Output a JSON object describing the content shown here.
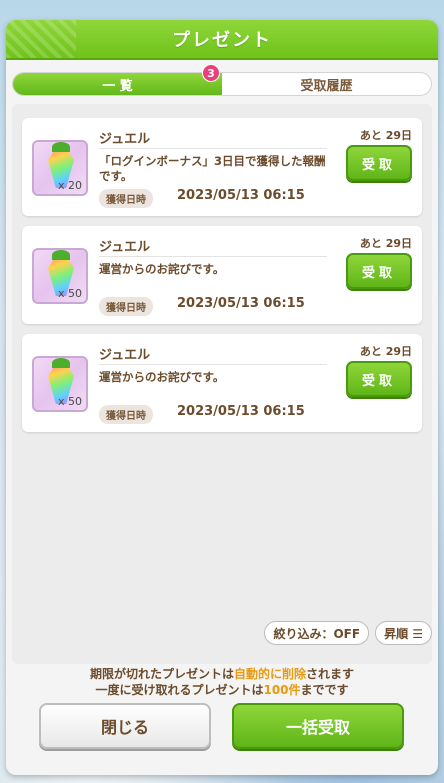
{
  "header": {
    "title": "プレゼント"
  },
  "tabs": [
    {
      "label": "一 覧",
      "badge": "3"
    },
    {
      "label": "受取履歴"
    }
  ],
  "items": [
    {
      "name": "ジュエル",
      "quantity": "x 20",
      "description": "「ログインボーナス」3日目で獲得した報酬です。",
      "date_label": "獲得日時",
      "date": "2023/05/13 06:15",
      "deadline": "あと 29日",
      "button": "受取"
    },
    {
      "name": "ジュエル",
      "quantity": "x 50",
      "description": "運営からのお詫びです。",
      "date_label": "獲得日時",
      "date": "2023/05/13 06:15",
      "deadline": "あと 29日",
      "button": "受取"
    },
    {
      "name": "ジュエル",
      "quantity": "x 50",
      "description": "運営からのお詫びです。",
      "date_label": "獲得日時",
      "date": "2023/05/13 06:15",
      "deadline": "あと 29日",
      "button": "受取"
    }
  ],
  "filters": {
    "narrow": "絞り込み：OFF",
    "sort": "昇順 ☰"
  },
  "notice": {
    "line1_pre": "期限が切れたプレゼントは",
    "line1_hl": "自動的に削除",
    "line1_post": "されます",
    "line2_pre": "一度に受け取れるプレゼントは",
    "line2_hl": "100件",
    "line2_post": "までです"
  },
  "buttons": {
    "close": "閉じる",
    "bulk": "一括受取"
  },
  "colors": {
    "accent_green": "#6fc31a",
    "badge_pink": "#e8407a",
    "text_brown": "#6b4b2b",
    "highlight_orange": "#e89a10"
  }
}
